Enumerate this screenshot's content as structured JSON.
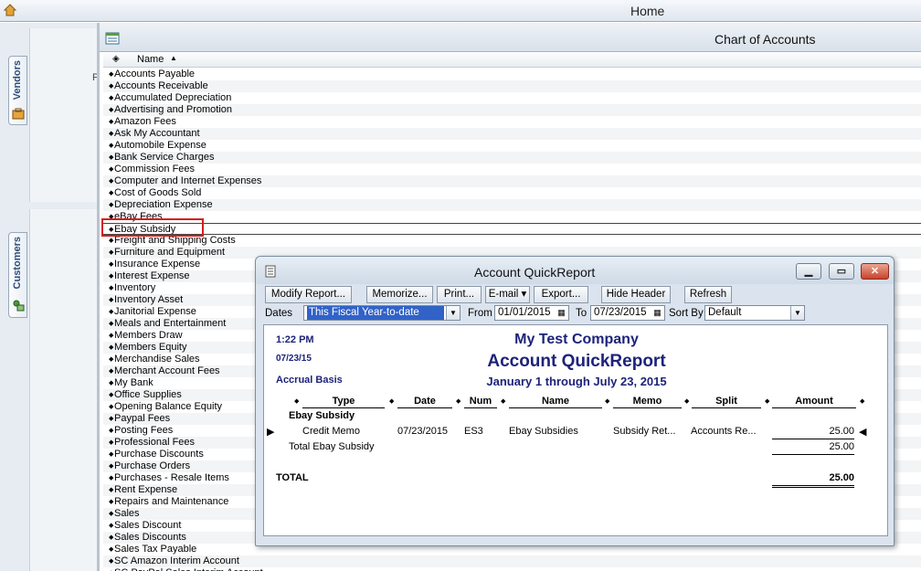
{
  "home": {
    "title": "Home"
  },
  "left_panel": {
    "partial_text": "P",
    "tabs": [
      {
        "label": "Vendors"
      },
      {
        "label": "Customers"
      }
    ]
  },
  "chart_of_accounts": {
    "title": "Chart of Accounts",
    "column_header": "Name",
    "accounts": [
      "Accounts Payable",
      "Accounts Receivable",
      "Accumulated Depreciation",
      "Advertising and Promotion",
      "Amazon Fees",
      "Ask My Accountant",
      "Automobile Expense",
      "Bank Service Charges",
      "Commission Fees",
      "Computer and Internet Expenses",
      "Cost of Goods Sold",
      "Depreciation Expense",
      "eBay Fees",
      "Ebay Subsidy",
      "Freight and Shipping Costs",
      "Furniture and Equipment",
      "Insurance Expense",
      "Interest Expense",
      "Inventory",
      "Inventory Asset",
      "Janitorial Expense",
      "Meals and Entertainment",
      "Members Draw",
      "Members Equity",
      "Merchandise Sales",
      "Merchant Account Fees",
      "My Bank",
      "Office Supplies",
      "Opening Balance Equity",
      "Paypal Fees",
      "Posting Fees",
      "Professional Fees",
      "Purchase Discounts",
      "Purchase Orders",
      "Purchases - Resale Items",
      "Rent Expense",
      "Repairs and Maintenance",
      "Sales",
      "Sales Discount",
      "Sales Discounts",
      "Sales Tax Payable",
      "SC Amazon Interim Account",
      "SC PayPal Sales Interim Account"
    ],
    "selected_account": "Ebay Subsidy"
  },
  "quickreport": {
    "window_title": "Account QuickReport",
    "toolbar": {
      "modify": "Modify Report...",
      "memorize": "Memorize...",
      "print": "Print...",
      "email": "E-mail ▾",
      "export": "Export...",
      "hide_header": "Hide Header",
      "refresh": "Refresh"
    },
    "filters": {
      "dates_label": "Dates",
      "dates_value": "This Fiscal Year-to-date",
      "from_label": "From",
      "from_value": "01/01/2015",
      "to_label": "To",
      "to_value": "07/23/2015",
      "sort_label": "Sort By",
      "sort_value": "Default"
    },
    "report": {
      "time": "1:22 PM",
      "date": "07/23/15",
      "basis": "Accrual Basis",
      "company": "My Test Company",
      "title": "Account QuickReport",
      "range": "January 1 through July 23, 2015",
      "columns": [
        "Type",
        "Date",
        "Num",
        "Name",
        "Memo",
        "Split",
        "Amount"
      ],
      "group_label": "Ebay Subsidy",
      "row": {
        "type": "Credit Memo",
        "date": "07/23/2015",
        "num": "ES3",
        "name": "Ebay Subsidies",
        "memo": "Subsidy Ret...",
        "split": "Accounts Re...",
        "amount": "25.00"
      },
      "group_total_label": "Total Ebay Subsidy",
      "group_total": "25.00",
      "total_label": "TOTAL",
      "total": "25.00"
    }
  }
}
